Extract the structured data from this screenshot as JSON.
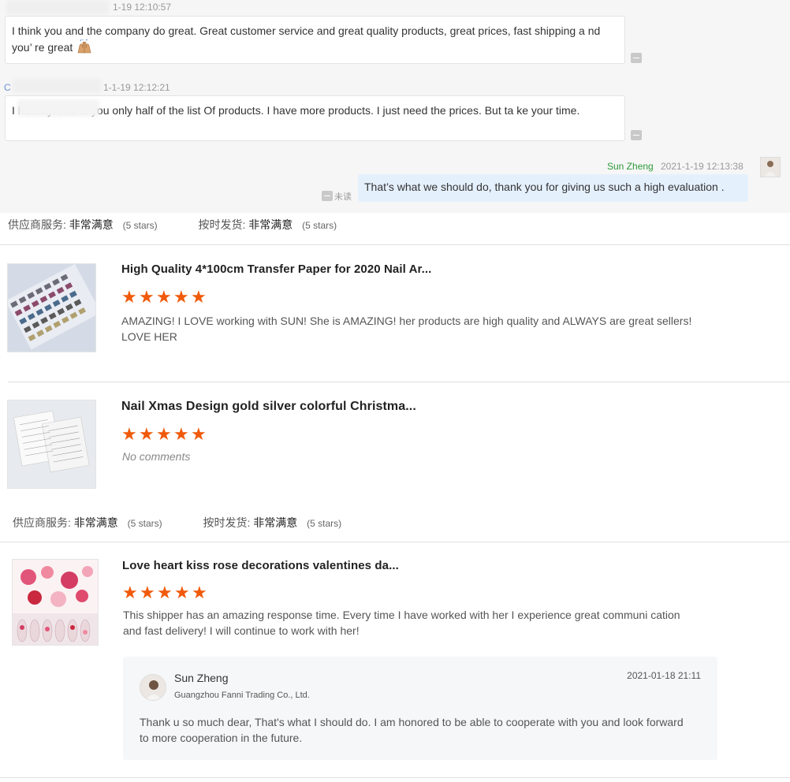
{
  "chat": {
    "messages": [
      {
        "timestamp": "1-19 12:10:57",
        "text": "I think you and the company do great. Great customer service and great quality products, great prices, fast shipping a nd you’ re great"
      },
      {
        "timestamp": "1-1-19 12:12:21",
        "text": "I  holiday. I send you only half of the list Of products. I have more products. I just need the prices. But ta ke your time."
      }
    ],
    "reply": {
      "sender": "Sun Zheng",
      "timestamp": "2021-1-19 12:13:38",
      "status": "未读",
      "text": "That’s what we should do, thank you for giving us such a high evaluation ."
    }
  },
  "ratings": [
    {
      "service_label": "供应商服务:",
      "service_value": "非常满意",
      "service_stars": "(5 stars)",
      "ship_label": "按时发货:",
      "ship_value": "非常满意",
      "ship_stars": "(5 stars)"
    },
    {
      "service_label": "供应商服务:",
      "service_value": "非常满意",
      "service_stars": "(5 stars)",
      "ship_label": "按时发货:",
      "ship_value": "非常满意",
      "ship_stars": "(5 stars)"
    }
  ],
  "reviews": [
    {
      "title": "High Quality 4*100cm Transfer Paper for 2020 Nail Ar...",
      "stars": 5,
      "text": "AMAZING! I LOVE working with SUN! She is AMAZING! her products are high quality and ALWAYS are great sellers! LOVE HER"
    },
    {
      "title": "Nail Xmas Design gold silver colorful Christma...",
      "stars": 5,
      "text": "No comments"
    },
    {
      "title": "Love heart kiss rose decorations valentines da...",
      "stars": 5,
      "text": "This shipper has an amazing response time. Every time I have worked with her I experience great communi cation and fast delivery! I will continue to work with her!"
    }
  ],
  "seller_reply": {
    "name": "Sun Zheng",
    "company": "Guangzhou Fanni Trading Co., Ltd.",
    "date": "2021-01-18 21:11",
    "text": "Thank u so much dear, That's what I should do. I am honored to be able to cooperate with you and look forward to more cooperation in the future."
  },
  "colors": {
    "star": "#f05a0a",
    "sender_name": "#2e9a3a",
    "my_bubble": "#e5f0fd"
  },
  "icons": {
    "star": "star-icon",
    "emoji": "raising-hands-emoji"
  }
}
